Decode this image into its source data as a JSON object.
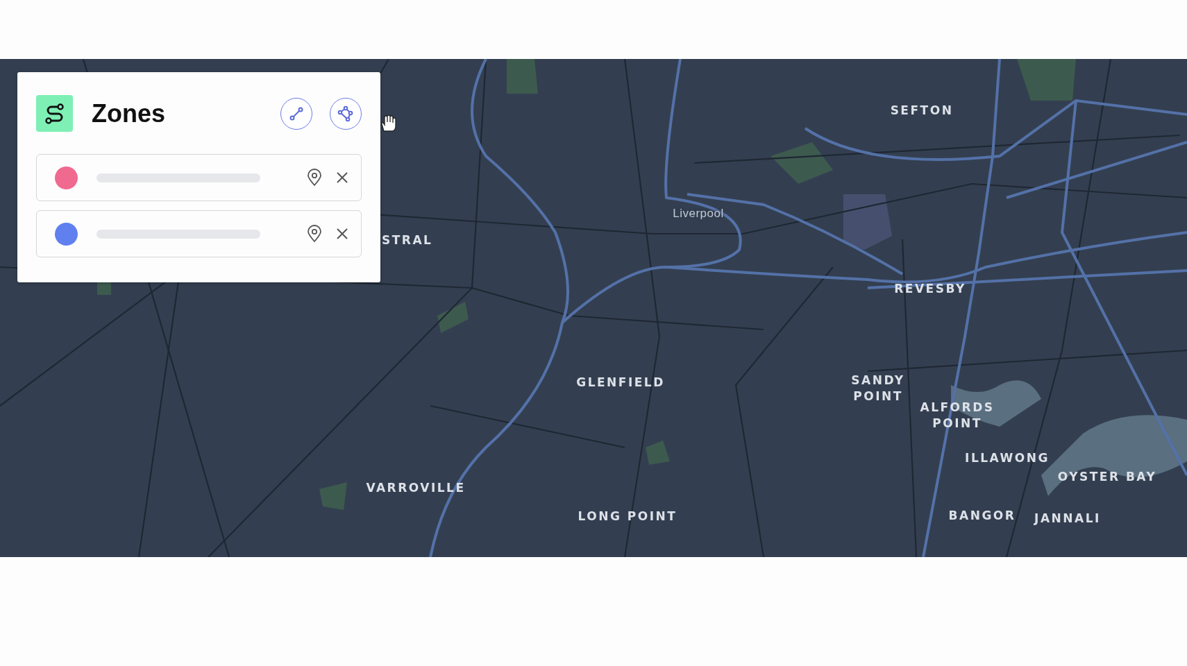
{
  "panel": {
    "title": "Zones",
    "zones": [
      {
        "color": "#f06a90"
      },
      {
        "color": "#6080f0"
      }
    ]
  },
  "map": {
    "labels": [
      {
        "text": "SEFTON",
        "kind": "suburb"
      },
      {
        "text": "Liverpool",
        "kind": "city"
      },
      {
        "text": "STRAL",
        "kind": "suburb"
      },
      {
        "text": "REVESBY",
        "kind": "suburb"
      },
      {
        "text": "GLENFIELD",
        "kind": "suburb"
      },
      {
        "text": "SANDY POINT",
        "kind": "suburb"
      },
      {
        "text": "ALFORDS POINT",
        "kind": "suburb"
      },
      {
        "text": "ILLAWONG",
        "kind": "suburb"
      },
      {
        "text": "OYSTER BAY",
        "kind": "suburb"
      },
      {
        "text": "VARROVILLE",
        "kind": "suburb"
      },
      {
        "text": "LONG POINT",
        "kind": "suburb"
      },
      {
        "text": "BANGOR",
        "kind": "suburb"
      },
      {
        "text": "JANNALI",
        "kind": "suburb"
      }
    ]
  }
}
